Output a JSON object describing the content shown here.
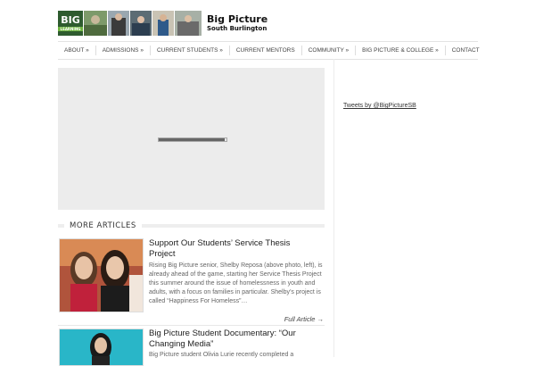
{
  "site": {
    "logo_word": "BIG",
    "logo_sub": "LEARNING",
    "title": "Big Picture",
    "subtitle": "South Burlington"
  },
  "nav": {
    "items": [
      "ABOUT »",
      "ADMISSIONS »",
      "CURRENT STUDENTS »",
      "CURRENT MENTORS",
      "COMMUNITY »",
      "BIG PICTURE & COLLEGE »",
      "CONTACT"
    ]
  },
  "slider": {
    "loading_progress": 0.97
  },
  "sidebar": {
    "tweets_link": "Tweets by @BigPictureSB"
  },
  "more_articles": {
    "heading": "MORE ARTICLES",
    "articles": [
      {
        "title": "Support Our Students’ Service Thesis Project",
        "excerpt": "Rising Big Picture senior, Shelby Reposa (above photo, left), is already ahead of the game, starting her Service Thesis Project this summer around the issue of homelessness in youth and adults, with a focus on families in particular. Shelby’s project is called “Happiness For Homeless”…",
        "more": "Full Article →"
      },
      {
        "title": "Big Picture Student Documentary: “Our Changing Media”",
        "excerpt": "Big Picture student Olivia Lurie recently completed a"
      }
    ]
  },
  "colors": {
    "accent": "#2e5b2f",
    "slider_bg": "#ececec"
  }
}
